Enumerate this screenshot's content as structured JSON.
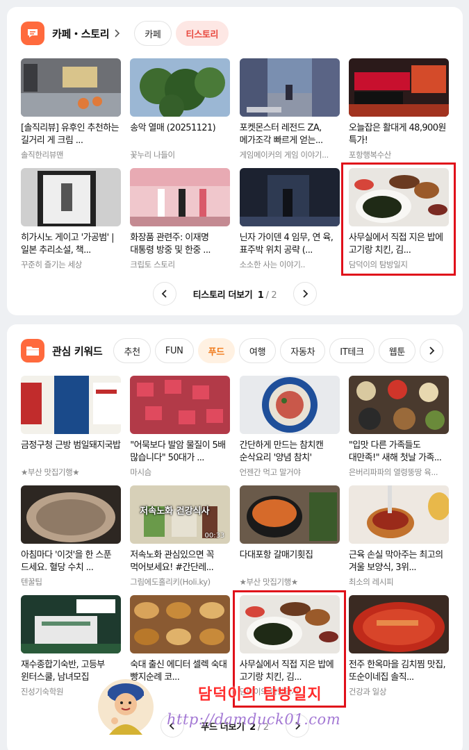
{
  "section1": {
    "title": "카페・스토리",
    "chips": [
      {
        "label": "카페",
        "active": false
      },
      {
        "label": "티스토리",
        "active": true
      }
    ],
    "items": [
      {
        "title": "[솔직리뷰] 유후인 추천하는 길거리 게 크림 ...",
        "source": "솔직한리뷰맨",
        "thumb": "shop-counter"
      },
      {
        "title": "송악 열매 (20251121)",
        "source": "꽃누리 나들이",
        "thumb": "ivy-leaves"
      },
      {
        "title": "포켓몬스터 레전드 ZA, 메가조각 빠르게 얻는...",
        "source": "게임메이커의 게임 이야기...",
        "thumb": "game-street"
      },
      {
        "title": "오늘잡은 활대게 48,900원 특가!",
        "source": "포항행복수산",
        "thumb": "crab-ad"
      },
      {
        "title": "히가시노 게이고 '가공범' | 일본 추리소설, 책...",
        "source": "꾸준히 즐기는 세상",
        "thumb": "book-cover"
      },
      {
        "title": "화장품 관련주: 이재명 대통령 방중 및 한중 ...",
        "source": "크립토 스토리",
        "thumb": "cosmetics-store"
      },
      {
        "title": "닌자 가이덴 4 임무, 연 육, 표주박 위치 공략 (...",
        "source": "소소한 사는 이야기..",
        "thumb": "game-dark"
      },
      {
        "title": "사무실에서 직접 지은 밥에 고기랑 치킨, 김...",
        "source": "담덕이의 탐방일지",
        "thumb": "lunch-plate"
      }
    ],
    "pager": {
      "label": "티스토리 더보기",
      "current": "1",
      "total": "/ 2"
    }
  },
  "section2": {
    "title": "관심 키워드",
    "chips": [
      {
        "label": "추천",
        "active": false
      },
      {
        "label": "FUN",
        "active": false
      },
      {
        "label": "푸드",
        "active": true
      },
      {
        "label": "여행",
        "active": false
      },
      {
        "label": "자동차",
        "active": false
      },
      {
        "label": "IT테크",
        "active": false
      },
      {
        "label": "웹툰",
        "active": false
      }
    ],
    "items": [
      {
        "title": "금정구청 근방 범일돼지국밥",
        "source": "★부산 맛집기행★",
        "thumb": "restaurant-sign"
      },
      {
        "title": "\"어묵보다 발암 물질이 5배 많습니다\" 50대가 ...",
        "source": "마시슴",
        "thumb": "meat-cubes"
      },
      {
        "title": "간단하게 만드는 참치캔 순삭요리 '양념 참치'",
        "source": "언젠간 먹고 말거야",
        "thumb": "tuna-plate"
      },
      {
        "title": "\"입맛 다른 가족들도 대만족!\" 새해 첫날 가족...",
        "source": "은버리파파의 열령뚱땅 육...",
        "thumb": "banchan-table"
      },
      {
        "title": "아침마다 '이것'을 한 스푼 드세요. 혈당 수치 ...",
        "source": "텐꿀팁",
        "thumb": "grains-bowl"
      },
      {
        "title": "저속노화 관심있으면 꼭 먹어보세요! #간단레...",
        "source": "그림에도홀리키(Holi.ky)",
        "thumb": "video-food",
        "caption": "저속노화 건강식사",
        "duration": "00:33"
      },
      {
        "title": "다대포항 갈매기횟집",
        "source": "★부산 맛집기행★",
        "thumb": "stew-pot"
      },
      {
        "title": "근육 손실 막아주는 최고의 겨울 보양식, 3위...",
        "source": "최소의 레시피",
        "thumb": "soup-spoon"
      },
      {
        "title": "재수종합기숙반, 고등부 윈터스쿨, 남녀모집",
        "source": "진성기숙학원",
        "thumb": "school-ad"
      },
      {
        "title": "숙대 출신 에디터 셀렉 숙대 빵지순례 코...",
        "source": "...스",
        "thumb": "bakery"
      },
      {
        "title": "사무실에서 직접 지은 밥에 고기랑 치킨, 김...",
        "source": "담덕이의 탐방일지",
        "thumb": "lunch-plate"
      },
      {
        "title": "전주 한옥마을 김치찜 맛집, 또순이네집 솔직...",
        "source": "건강과 일상",
        "thumb": "kimchi-stew"
      }
    ],
    "pager": {
      "label": "푸드 더보기",
      "current": "2",
      "total": "/ 2"
    }
  },
  "watermark": {
    "text": "담덕이의 탐방일지",
    "url": "http://damduck01.com"
  },
  "colors": {
    "accent_tistory": "#e8473d",
    "accent_food": "#f07a1a",
    "highlight_box": "#e0101a",
    "section_icon": "#ff6a3d"
  }
}
